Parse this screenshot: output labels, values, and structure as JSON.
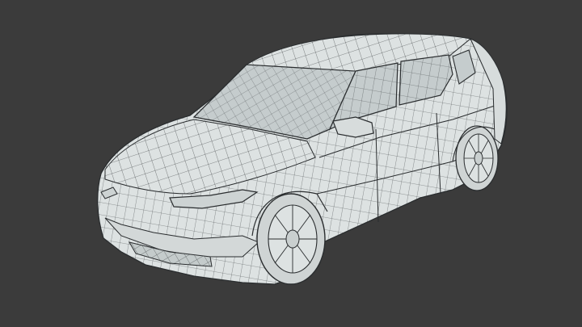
{
  "scene": {
    "background": "#3b3b3b",
    "surface": "#dde2e2",
    "surface_shade": "#c9cfcf",
    "glass": "#bfc7c9",
    "wire": "#2a2d2f",
    "tire": "#cfd4d4"
  }
}
